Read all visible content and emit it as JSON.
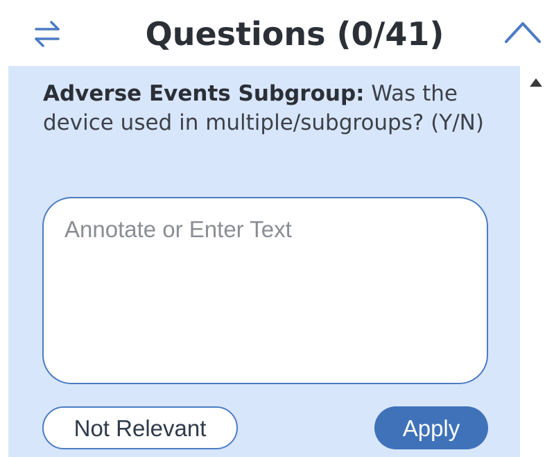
{
  "header": {
    "title": "Questions (0/41)"
  },
  "question": {
    "label_bold": "Adverse Events Subgroup:",
    "text": " Was the device used in multiple/subgroups? (Y/N)"
  },
  "answer_field": {
    "placeholder": "Annotate or Enter Text",
    "value": ""
  },
  "actions": {
    "not_relevant_label": "Not Relevant",
    "apply_label": "Apply"
  },
  "colors": {
    "accent": "#4b7bc2",
    "apply_bg": "#3f72b8",
    "panel_bg": "#d8e6fb",
    "title_text": "#2b2f36"
  },
  "icons": {
    "swap": "swap-arrows-icon",
    "collapse": "chevron-up-icon",
    "scroll_up": "scroll-up-arrow-icon"
  }
}
